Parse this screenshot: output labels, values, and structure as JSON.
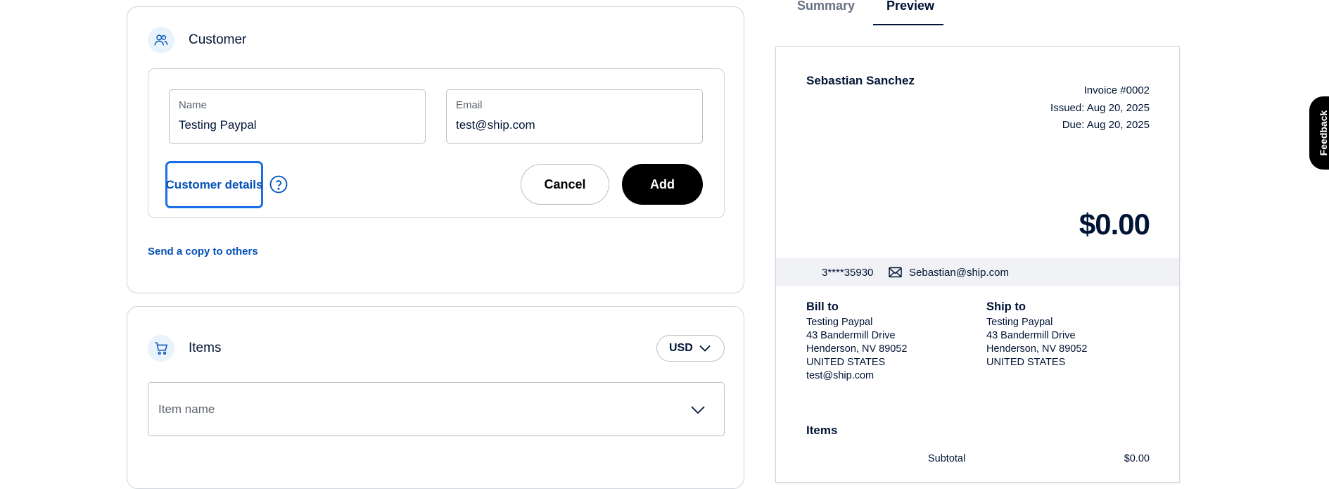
{
  "customer": {
    "title": "Customer",
    "name_label": "Name",
    "name_value": "Testing Paypal",
    "email_label": "Email",
    "email_value": "test@ship.com",
    "details_link": "Customer details",
    "cancel_label": "Cancel",
    "add_label": "Add",
    "send_copy_link": "Send a copy to others"
  },
  "items": {
    "title": "Items",
    "currency": "USD",
    "item_name_placeholder": "Item name"
  },
  "tabs": [
    {
      "label": "Summary",
      "active": false
    },
    {
      "label": "Preview",
      "active": true
    }
  ],
  "invoice": {
    "business_name": "Sebastian Sanchez",
    "invoice_number": "Invoice #0002",
    "issued": "Issued: Aug 20, 2025",
    "due": "Due: Aug 20, 2025",
    "amount": "$0.00",
    "phone": "3****35930",
    "business_email": "Sebastian@ship.com",
    "bill_to": {
      "heading": "Bill to",
      "lines": [
        "Testing Paypal",
        "43 Bandermill Drive",
        "Henderson, NV 89052",
        "UNITED STATES",
        "test@ship.com"
      ]
    },
    "ship_to": {
      "heading": "Ship to",
      "lines": [
        "Testing Paypal",
        "43 Bandermill Drive",
        "Henderson, NV 89052",
        "UNITED STATES"
      ]
    },
    "items_heading": "Items",
    "subtotal_label": "Subtotal",
    "subtotal_value": "$0.00"
  },
  "feedback_label": "Feedback",
  "colors": {
    "link": "#0551b5",
    "focus_ring": "#1a6ee6",
    "primary_button": "#000000",
    "icon_bg": "#e8f3fb",
    "text": "#001435"
  }
}
